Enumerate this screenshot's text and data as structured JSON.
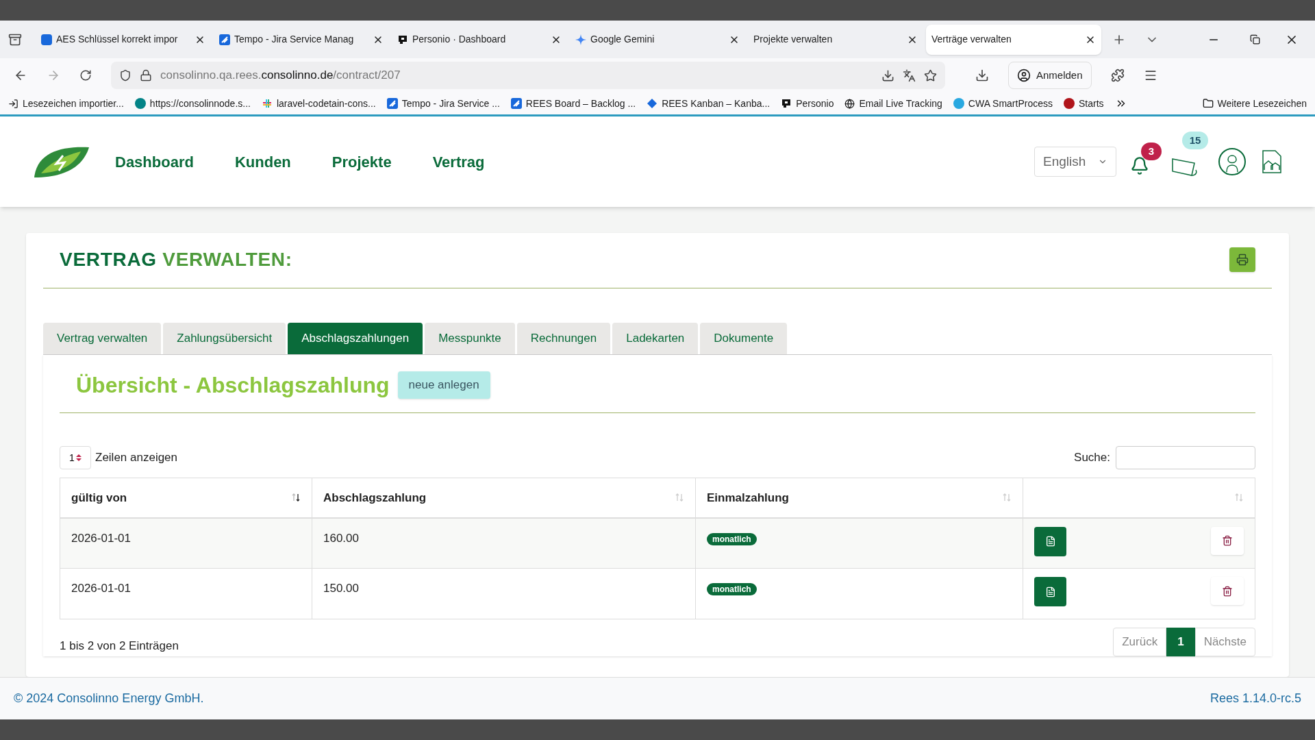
{
  "browser": {
    "tabs": [
      {
        "title": "AES Schlüssel korrekt impor",
        "selected": false
      },
      {
        "title": "Tempo - Jira Service Manag",
        "selected": false
      },
      {
        "title": "Personio · Dashboard",
        "selected": false
      },
      {
        "title": "Google Gemini",
        "selected": false
      },
      {
        "title": "Projekte verwalten",
        "selected": false
      },
      {
        "title": "Verträge verwalten",
        "selected": true
      }
    ],
    "url": {
      "host_prefix": "consolinno.qa.rees.",
      "domain": "consolinno.de",
      "path": "/contract/207"
    },
    "sign_in": "Anmelden",
    "bookmarks": [
      {
        "label": "Lesezeichen importier..."
      },
      {
        "label": "https://consolinnode.s..."
      },
      {
        "label": "laravel-codetain-cons..."
      },
      {
        "label": "Tempo - Jira Service ..."
      },
      {
        "label": "REES Board – Backlog ..."
      },
      {
        "label": "REES Kanban – Kanba..."
      },
      {
        "label": "Personio"
      },
      {
        "label": "Email Live Tracking"
      },
      {
        "label": "CWA SmartProcess"
      },
      {
        "label": "Starts"
      }
    ],
    "other_bookmarks": "Weitere Lesezeichen"
  },
  "nav": {
    "items": [
      "Dashboard",
      "Kunden",
      "Projekte",
      "Vertrag"
    ],
    "language": "English",
    "notifications": "3",
    "news": "15"
  },
  "page": {
    "title_a": "VERTRAG",
    "title_b": "VERWALTEN:",
    "tabs": [
      {
        "label": "Vertrag verwalten",
        "selected": false
      },
      {
        "label": "Zahlungsübersicht",
        "selected": false
      },
      {
        "label": "Abschlagszahlungen",
        "selected": true
      },
      {
        "label": "Messpunkte",
        "selected": false
      },
      {
        "label": "Rechnungen",
        "selected": false
      },
      {
        "label": "Ladekarten",
        "selected": false
      },
      {
        "label": "Dokumente",
        "selected": false
      }
    ],
    "section_title": "Übersicht - Abschlagszahlung",
    "new_button": "neue anlegen",
    "length_value": "1",
    "length_label": "Zeilen anzeigen",
    "search_label": "Suche:",
    "table": {
      "columns": [
        {
          "label": "gültig von",
          "sorted": true
        },
        {
          "label": "Abschlagszahlung",
          "sorted": false
        },
        {
          "label": "Einmalzahlung",
          "sorted": false
        },
        {
          "sorted": false
        }
      ],
      "rows": [
        {
          "date": "2026-01-01",
          "amount": "160.00",
          "badge": "monatlich"
        },
        {
          "date": "2026-01-01",
          "amount": "150.00",
          "badge": "monatlich"
        }
      ]
    },
    "info": "1 bis 2 von 2 Einträgen",
    "pagination": {
      "prev": "Zurück",
      "page": "1",
      "next": "Nächste"
    }
  },
  "footer": {
    "copyright": "© 2024 Consolinno Energy GmbH.",
    "version": "Rees 1.14.0-rc.5"
  }
}
